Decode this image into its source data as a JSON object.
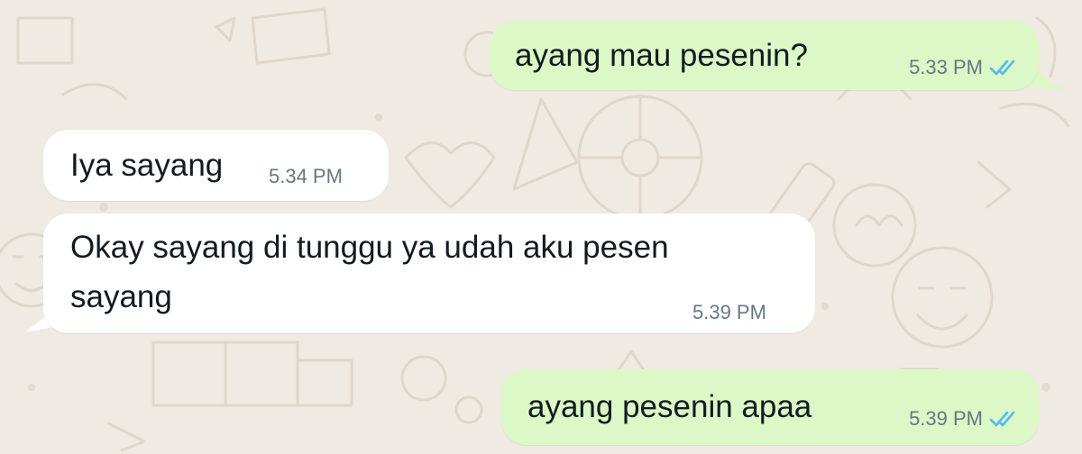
{
  "colors": {
    "background": "#efeae2",
    "outgoing_bubble": "#dcf8c6",
    "incoming_bubble": "#ffffff",
    "text": "#111b21",
    "timestamp": "#667781",
    "read_ticks": "#53bdeb"
  },
  "messages": [
    {
      "direction": "outgoing",
      "text": "ayang mau pesenin?",
      "time": "5.33 PM",
      "status_icon": "double-check-read-icon"
    },
    {
      "direction": "incoming",
      "text": "Iya sayang",
      "time": "5.34 PM"
    },
    {
      "direction": "incoming",
      "text_line_1": "Okay sayang di tunggu ya udah aku pesen",
      "text_line_2": "sayang",
      "time": "5.39 PM"
    },
    {
      "direction": "outgoing",
      "text": "ayang pesenin apaa",
      "time": "5.39 PM",
      "status_icon": "double-check-read-icon"
    }
  ]
}
